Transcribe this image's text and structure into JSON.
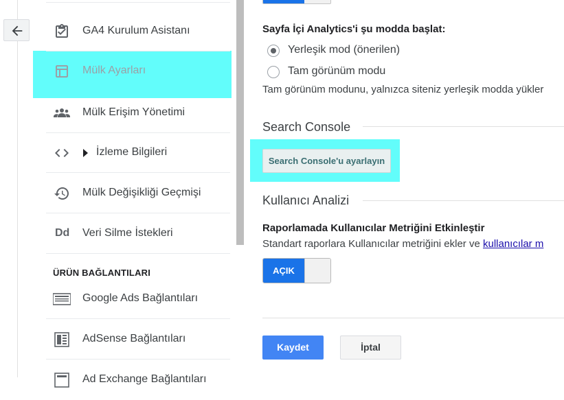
{
  "nav": {
    "back_icon": "arrow-left-icon",
    "items": [
      {
        "label": "GA4 Kurulum Asistanı",
        "icon": "clipboard-check-icon"
      },
      {
        "label": "Mülk Ayarları",
        "icon": "property-layout-icon",
        "highlighted": true
      },
      {
        "label": "Mülk Erişim Yönetimi",
        "icon": "people-icon"
      },
      {
        "label": "İzleme Bilgileri",
        "icon": "code-icon",
        "expand_icon": "triangle-right-icon"
      },
      {
        "label": "Mülk Değişikliği Geçmişi",
        "icon": "history-icon"
      },
      {
        "label": "Veri Silme İstekleri",
        "icon": "dd-icon",
        "icon_text": "Dd"
      }
    ],
    "section_title": "ÜRÜN BAĞLANTILARI",
    "product_items": [
      {
        "label": "Google Ads Bağlantıları",
        "icon": "google-ads-icon"
      },
      {
        "label": "AdSense Bağlantıları",
        "icon": "adsense-icon"
      },
      {
        "label": "Ad Exchange Bağlantıları",
        "icon": "ad-exchange-icon"
      }
    ]
  },
  "main": {
    "page_analytics": {
      "label": "Sayfa İçi Analytics'i şu modda başlat:",
      "options": [
        {
          "label": "Yerleşik mod (önerilen)",
          "checked": true
        },
        {
          "label": "Tam görünüm modu",
          "checked": false
        }
      ],
      "helper": "Tam görünüm modunu, yalnızca siteniz yerleşik modda yükler"
    },
    "search_console": {
      "heading": "Search Console",
      "button": "Search Console'u ayarlayın"
    },
    "user_analysis": {
      "heading": "Kullanıcı Analizi",
      "label": "Raporlamada Kullanıcılar Metriğini Etkinleştir",
      "helper_prefix": "Standart raporlara Kullanıcılar metriğini ekler ve ",
      "helper_link": "kullanıcılar m",
      "toggle_label": "AÇIK"
    },
    "actions": {
      "save": "Kaydet",
      "cancel": "İptal"
    }
  },
  "colors": {
    "highlight": "#62fdfb",
    "primary": "#4285f4",
    "toggle_on": "#1a73e8"
  }
}
